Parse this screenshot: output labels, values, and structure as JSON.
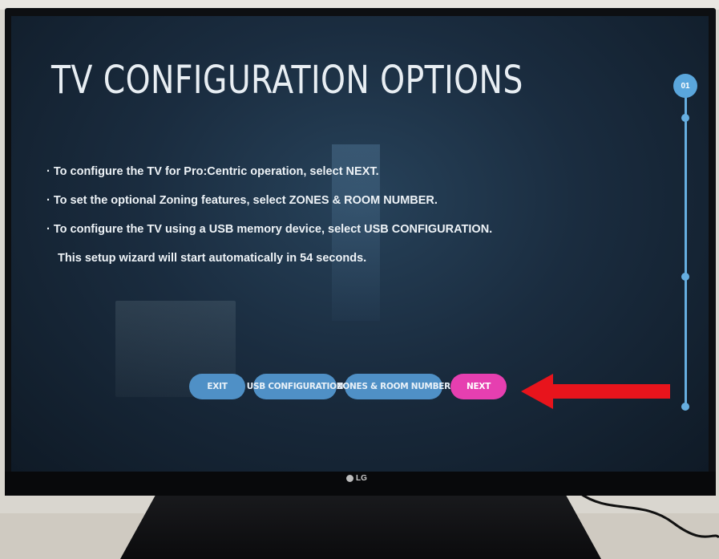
{
  "screen": {
    "title": "TV CONFIGURATION OPTIONS",
    "instructions": [
      "· To configure the TV for Pro:Centric operation, select NEXT.",
      "· To set the optional Zoning features, select ZONES & ROOM NUMBER.",
      "· To configure the TV using a USB memory device, select USB CONFIGURATION.",
      "This setup wizard will start automatically in 54 seconds."
    ],
    "buttons": {
      "exit": "EXIT",
      "usb": "USB CONFIGURATION",
      "zones": "ZONES & ROOM NUMBER",
      "next": "NEXT"
    },
    "step": {
      "current": "01"
    }
  },
  "tv": {
    "brand": "LG"
  },
  "colors": {
    "button_blue": "#4f90c6",
    "next_pink": "#e63fb0",
    "arrow_red": "#e8141c",
    "stepper_blue": "#66aee0"
  },
  "icons": [
    "red-arrow-pointer-icon",
    "lg-logo-icon"
  ]
}
